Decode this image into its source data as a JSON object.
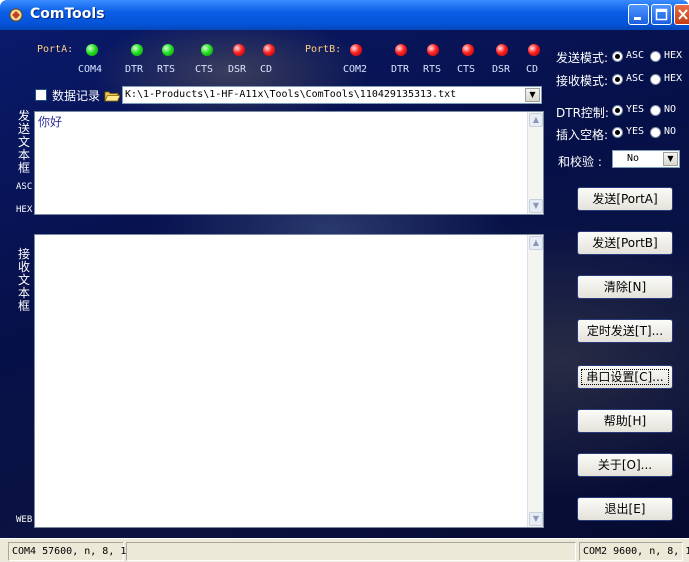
{
  "window": {
    "title": "ComTools"
  },
  "port_a": {
    "label": "PortA:",
    "indicators": [
      {
        "label": "COM4",
        "state": "green"
      },
      {
        "label": "DTR",
        "state": "green"
      },
      {
        "label": "RTS",
        "state": "green"
      },
      {
        "label": "CTS",
        "state": "green"
      },
      {
        "label": "DSR",
        "state": "red"
      },
      {
        "label": "CD",
        "state": "red"
      }
    ]
  },
  "port_b": {
    "label": "PortB:",
    "indicators": [
      {
        "label": "COM2",
        "state": "red"
      },
      {
        "label": "DTR",
        "state": "red"
      },
      {
        "label": "RTS",
        "state": "red"
      },
      {
        "label": "CTS",
        "state": "red"
      },
      {
        "label": "DSR",
        "state": "red"
      },
      {
        "label": "CD",
        "state": "red"
      }
    ]
  },
  "logging": {
    "checkbox_label": "数据记录",
    "checked": false,
    "file_path": "K:\\1-Products\\1-HF-A11x\\Tools\\ComTools\\110429135313.txt"
  },
  "send_panel": {
    "vertical_label": "发送文本框",
    "asc_label": "ASC",
    "hex_label": "HEX",
    "content": "你好"
  },
  "receive_panel": {
    "vertical_label": "接收文本框",
    "web_label": "WEB",
    "content": ""
  },
  "settings": {
    "send_mode": {
      "label": "发送模式:",
      "options": [
        "ASC",
        "HEX"
      ],
      "selected": "ASC"
    },
    "receive_mode": {
      "label": "接收模式:",
      "options": [
        "ASC",
        "HEX"
      ],
      "selected": "ASC"
    },
    "dtr_control": {
      "label": "DTR控制:",
      "options": [
        "YES",
        "NO"
      ],
      "selected": "YES"
    },
    "insert_space": {
      "label": "插入空格:",
      "options": [
        "YES",
        "NO"
      ],
      "selected": "YES"
    },
    "checksum": {
      "label": "和校验 :",
      "value": "No"
    }
  },
  "buttons": {
    "send_a": "发送[PortA]",
    "send_b": "发送[PortB]",
    "clear": "清除[N]",
    "timed_send": "定时发送[T]...",
    "serial_settings": "串口设置[C]...",
    "help": "帮助[H]",
    "about": "关于[O]...",
    "exit": "退出[E]"
  },
  "status": {
    "left": "COM4 57600, n, 8, 1",
    "right": "COM2 9600, n, 8, 1"
  },
  "colors": {
    "titlebar": "#0553d8",
    "background": "#061049",
    "led_green": "#24e024",
    "led_red": "#ff2020",
    "send_text": "#3030a0"
  }
}
